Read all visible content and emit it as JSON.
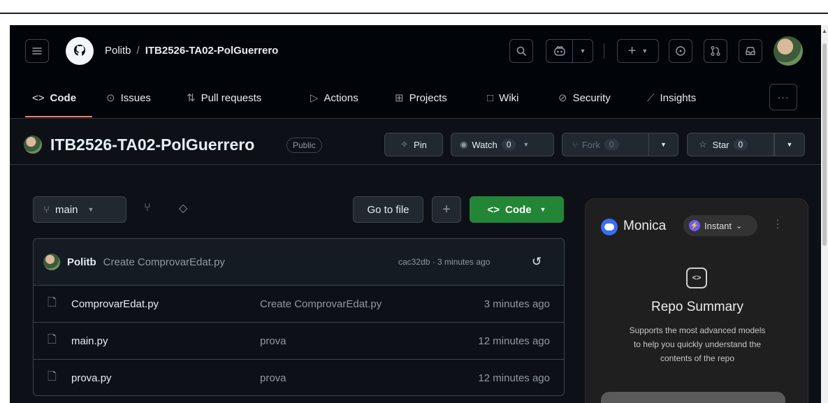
{
  "header": {
    "owner": "Politb",
    "separator": "/",
    "repo": "ITB2526-TA02-PolGuerrero",
    "icons": [
      "hamburger-icon",
      "github-logo-icon",
      "search-icon",
      "copilot-icon",
      "plus-icon",
      "issues-icon",
      "pull-request-icon",
      "inbox-icon"
    ]
  },
  "tabs": [
    {
      "label": "Code",
      "icon": "code-icon"
    },
    {
      "label": "Issues",
      "icon": "issue-icon"
    },
    {
      "label": "Pull requests",
      "icon": "pull-request-icon"
    },
    {
      "label": "Actions",
      "icon": "play-icon"
    },
    {
      "label": "Projects",
      "icon": "table-icon"
    },
    {
      "label": "Wiki",
      "icon": "book-icon"
    },
    {
      "label": "Security",
      "icon": "shield-icon"
    },
    {
      "label": "Insights",
      "icon": "graph-icon"
    }
  ],
  "repo": {
    "name": "ITB2526-TA02-PolGuerrero",
    "visibility": "Public",
    "pin_label": "Pin",
    "watch_label": "Watch",
    "watch_count": "0",
    "fork_label": "Fork",
    "fork_count": "0",
    "star_label": "Star",
    "star_count": "0"
  },
  "toolbar": {
    "branch": "main",
    "go_to_file": "Go to file",
    "add": "+",
    "code_button": "Code"
  },
  "commit": {
    "author": "Politb",
    "message": "Create ComprovarEdat.py",
    "meta": "cac32db · 3 minutes ago"
  },
  "files": [
    {
      "name": "ComprovarEdat.py",
      "message": "Create ComprovarEdat.py",
      "time": "3 minutes ago"
    },
    {
      "name": "main.py",
      "message": "prova",
      "time": "12 minutes ago"
    },
    {
      "name": "prova.py",
      "message": "prova",
      "time": "12 minutes ago"
    }
  ],
  "monica": {
    "name": "Monica",
    "mode": "Instant",
    "title": "Repo Summary",
    "desc1": "Supports the most advanced models",
    "desc2": "to help you quickly understand the",
    "desc3": "contents of the repo"
  },
  "colors": {
    "bg": "#0d1117",
    "header_bg": "#010409",
    "accent_tab": "#f78166",
    "code_button": "#238636",
    "border": "#3d444d",
    "muted": "#9198a1"
  }
}
